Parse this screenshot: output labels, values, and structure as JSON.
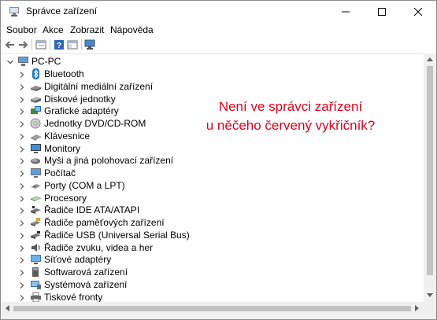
{
  "window": {
    "title": "Správce zařízení",
    "icon": "device-manager-icon",
    "controls": [
      "minimize-icon",
      "maximize-icon",
      "close-icon"
    ]
  },
  "menu": {
    "items": [
      "Soubor",
      "Akce",
      "Zobrazit",
      "Nápověda"
    ]
  },
  "toolbar": {
    "buttons": [
      "back-arrow-icon",
      "forward-arrow-icon",
      "properties-icon",
      "help-icon",
      "console-tree-icon",
      "scan-hardware-icon"
    ]
  },
  "tree": {
    "root": "PC-PC",
    "categories": [
      {
        "label": "Bluetooth",
        "icon": "bluetooth-icon"
      },
      {
        "label": "Digitální mediální zařízení",
        "icon": "media-device-icon"
      },
      {
        "label": "Diskové jednotky",
        "icon": "disk-drive-icon"
      },
      {
        "label": "Grafické adaptéry",
        "icon": "display-adapter-icon"
      },
      {
        "label": "Jednotky DVD/CD-ROM",
        "icon": "dvd-drive-icon"
      },
      {
        "label": "Klávesnice",
        "icon": "keyboard-icon"
      },
      {
        "label": "Monitory",
        "icon": "monitor-icon"
      },
      {
        "label": "Myši a jiná polohovací zařízení",
        "icon": "mouse-icon"
      },
      {
        "label": "Počítač",
        "icon": "computer-icon"
      },
      {
        "label": "Porty (COM a LPT)",
        "icon": "port-icon"
      },
      {
        "label": "Procesory",
        "icon": "processor-icon"
      },
      {
        "label": "Řadiče IDE ATA/ATAPI",
        "icon": "ide-controller-icon"
      },
      {
        "label": "Řadiče paměťových zařízení",
        "icon": "storage-controller-icon"
      },
      {
        "label": "Řadiče USB (Universal Serial Bus)",
        "icon": "usb-icon"
      },
      {
        "label": "Řadiče zvuku, videa a her",
        "icon": "sound-icon"
      },
      {
        "label": "Síťové adaptéry",
        "icon": "network-adapter-icon"
      },
      {
        "label": "Softwarová zařízení",
        "icon": "software-device-icon"
      },
      {
        "label": "Systémová zařízení",
        "icon": "system-device-icon"
      },
      {
        "label": "Tiskové fronty",
        "icon": "print-queue-icon"
      }
    ]
  },
  "annotation": {
    "line1": "Není ve správci zařízení",
    "line2": "u něčeho červený vykřičník?",
    "color": "#e0001a"
  },
  "colors": {
    "accent": "#1a73c7",
    "scrollbar_thumb": "#c2c2c2"
  }
}
